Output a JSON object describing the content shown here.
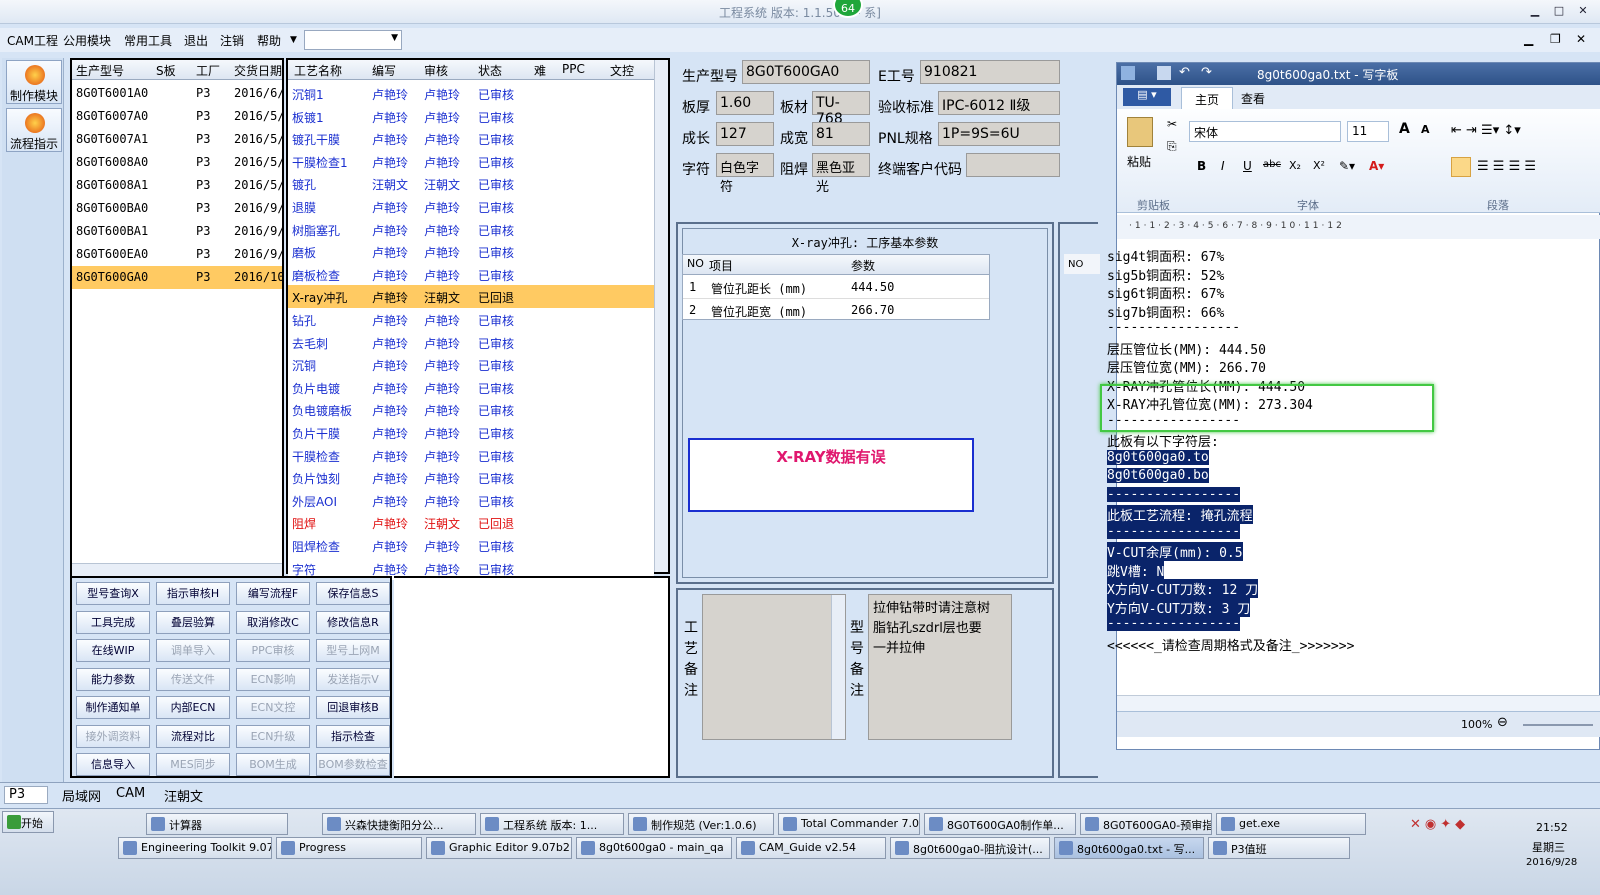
{
  "window": {
    "title": "工程系统  版本: 1.1.50.4  -",
    "title_suffix": "系]",
    "badge": "64"
  },
  "menu": [
    "CAM工程",
    "公用模块",
    "常用工具",
    "退出",
    "注销",
    "帮助"
  ],
  "sidebar": [
    "制作模块",
    "流程指示"
  ],
  "models": {
    "headers": [
      "生产型号",
      "S板",
      "工厂",
      "交货日期"
    ],
    "rows": [
      [
        "8G0T6001A0",
        "",
        "P3",
        "2016/6/"
      ],
      [
        "8G0T6007A0",
        "",
        "P3",
        "2016/5/"
      ],
      [
        "8G0T6007A1",
        "",
        "P3",
        "2016/5/"
      ],
      [
        "8G0T6008A0",
        "",
        "P3",
        "2016/5/"
      ],
      [
        "8G0T6008A1",
        "",
        "P3",
        "2016/5/"
      ],
      [
        "8G0T600BA0",
        "",
        "P3",
        "2016/9/"
      ],
      [
        "8G0T600BA1",
        "",
        "P3",
        "2016/9/"
      ],
      [
        "8G0T600EA0",
        "",
        "P3",
        "2016/9/"
      ],
      [
        "8G0T600GA0",
        "",
        "P3",
        "2016/10"
      ]
    ]
  },
  "process": {
    "headers": [
      "工艺名称",
      "编写",
      "审核",
      "状态",
      "难",
      "PPC",
      "文控"
    ],
    "rows": [
      [
        "沉铜1",
        "卢艳玲",
        "卢艳玲",
        "已审核"
      ],
      [
        "板镀1",
        "卢艳玲",
        "卢艳玲",
        "已审核"
      ],
      [
        "镀孔干膜",
        "卢艳玲",
        "卢艳玲",
        "已审核"
      ],
      [
        "干膜检查1",
        "卢艳玲",
        "卢艳玲",
        "已审核"
      ],
      [
        "镀孔",
        "汪朝文",
        "汪朝文",
        "已审核"
      ],
      [
        "退膜",
        "卢艳玲",
        "卢艳玲",
        "已审核"
      ],
      [
        "树脂塞孔",
        "卢艳玲",
        "卢艳玲",
        "已审核"
      ],
      [
        "磨板",
        "卢艳玲",
        "卢艳玲",
        "已审核"
      ],
      [
        "磨板检查",
        "卢艳玲",
        "卢艳玲",
        "已审核"
      ],
      [
        "X-ray冲孔",
        "卢艳玲",
        "汪朝文",
        "已回退"
      ],
      [
        "钻孔",
        "卢艳玲",
        "卢艳玲",
        "已审核"
      ],
      [
        "去毛刺",
        "卢艳玲",
        "卢艳玲",
        "已审核"
      ],
      [
        "沉铜",
        "卢艳玲",
        "卢艳玲",
        "已审核"
      ],
      [
        "负片电镀",
        "卢艳玲",
        "卢艳玲",
        "已审核"
      ],
      [
        "负电镀磨板",
        "卢艳玲",
        "卢艳玲",
        "已审核"
      ],
      [
        "负片干膜",
        "卢艳玲",
        "卢艳玲",
        "已审核"
      ],
      [
        "干膜检查",
        "卢艳玲",
        "卢艳玲",
        "已审核"
      ],
      [
        "负片蚀刻",
        "卢艳玲",
        "卢艳玲",
        "已审核"
      ],
      [
        "外层AOI",
        "卢艳玲",
        "卢艳玲",
        "已审核"
      ],
      [
        "阻焊",
        "卢艳玲",
        "汪朝文",
        "已回退"
      ],
      [
        "阻焊检查",
        "卢艳玲",
        "卢艳玲",
        "已审核"
      ],
      [
        "字符",
        "卢艳玲",
        "卢艳玲",
        "已审核"
      ]
    ]
  },
  "buttons": [
    [
      "型号查询X",
      "指示审核H",
      "编写流程F",
      "保存信息S"
    ],
    [
      "工具完成",
      "叠层验算",
      "取消修改C",
      "修改信息R"
    ],
    [
      "在线WIP",
      "调单导入",
      "PPC审核",
      "型号上网M"
    ],
    [
      "能力参数",
      "传送文件",
      "ECN影响",
      "发送指示V"
    ],
    [
      "制作通知单",
      "内部ECN",
      "ECN文控",
      "回退审核B"
    ],
    [
      "接外调资料",
      "流程对比",
      "ECN升级",
      "指示检查"
    ],
    [
      "信息导入",
      "MES同步",
      "BOM生成",
      "BOM参数检查"
    ]
  ],
  "info": {
    "model_label": "生产型号",
    "model": "8G0T600GA0",
    "eno_label": "E工号",
    "eno": "910821",
    "thick_label": "板厚",
    "thick": "1.60",
    "mat_label": "板材",
    "mat": "TU-768",
    "std_label": "验收标准",
    "std": "IPC-6012 Ⅱ级",
    "len_label": "成长",
    "len": "127",
    "wid_label": "成宽",
    "wid": "81",
    "pnl_label": "PNL规格",
    "pnl": "1P=9S=6U",
    "char_label": "字符",
    "char": "白色字符",
    "mask_label": "阻焊",
    "mask": "黑色亚光",
    "cust_label": "终端客户代码",
    "cust": ""
  },
  "xray": {
    "title": "X-ray冲孔: 工序基本参数",
    "headers": [
      "NO",
      "项目",
      "参数"
    ],
    "rows": [
      [
        "1",
        "管位孔距长 (mm)",
        "444.50"
      ],
      [
        "2",
        "管位孔距宽 (mm)",
        "266.70"
      ]
    ],
    "warning": "X-RAY数据有误",
    "no_label": "NO"
  },
  "remarks": {
    "proc_label": "工艺备注",
    "model_label": "型号备注",
    "model_text": "拉伸钻带时请注意树脂钻孔szdrl层也要一并拉伸"
  },
  "wordpad": {
    "title": "8g0t600ga0.txt - 写字板",
    "tabs": [
      "主页",
      "查看"
    ],
    "font": "宋体",
    "size": "11",
    "groups": [
      "剪贴板",
      "字体",
      "段落"
    ],
    "paste": "粘贴",
    "lines": [
      "sig4t铜面积: 67%",
      "sig5b铜面积: 52%",
      "sig6t铜面积: 67%",
      "sig7b铜面积: 66%",
      "-----------------",
      "层压管位长(MM): 444.50",
      "层压管位宽(MM): 266.70",
      "X-RAY冲孔管位长(MM): 444.50",
      "X-RAY冲孔管位宽(MM): 273.304",
      "-----------------",
      "此板有以下字符层:",
      "8g0t600ga0.to",
      "8g0t600ga0.bo",
      "-----------------",
      "此板工艺流程: 掩孔流程",
      "-----------------",
      "V-CUT余厚(mm): 0.5",
      "跳V槽: N",
      "X方向V-CUT刀数: 12 刀",
      "Y方向V-CUT刀数: 3 刀",
      "-----------------",
      "<<<<<<_请检查周期格式及备注_>>>>>>>"
    ],
    "zoom": "100%"
  },
  "status": {
    "p3": "P3",
    "tabs": [
      "局域网",
      "CAM",
      "汪朝文"
    ]
  },
  "taskbar": {
    "start": "开始",
    "row1": [
      "计算器",
      "兴森快捷衡阳分公...",
      "工程系统  版本: 1...",
      "制作规范 (Ver:1.0.6)",
      "Total Commander 7.0 ...",
      "8G0T600GA0制作单...",
      "8G0T600GA0-预审指...",
      "get.exe"
    ],
    "row2": [
      "Engineering Toolkit 9.07...",
      "Progress",
      "Graphic Editor 9.07b2 (...",
      "8g0t600ga0 - main_qa",
      "CAM_Guide v2.54",
      "8g0t600ga0-阻抗设计(...",
      "8g0t600ga0.txt - 写...",
      "P3值班"
    ],
    "time": "21:52",
    "day": "星期三",
    "date": "2016/9/28"
  },
  "colors": {
    "highlight": "#ffca62",
    "warning_border": "#1a2fd0",
    "warning_text": "#e0176e",
    "green_box": "#43c843"
  }
}
